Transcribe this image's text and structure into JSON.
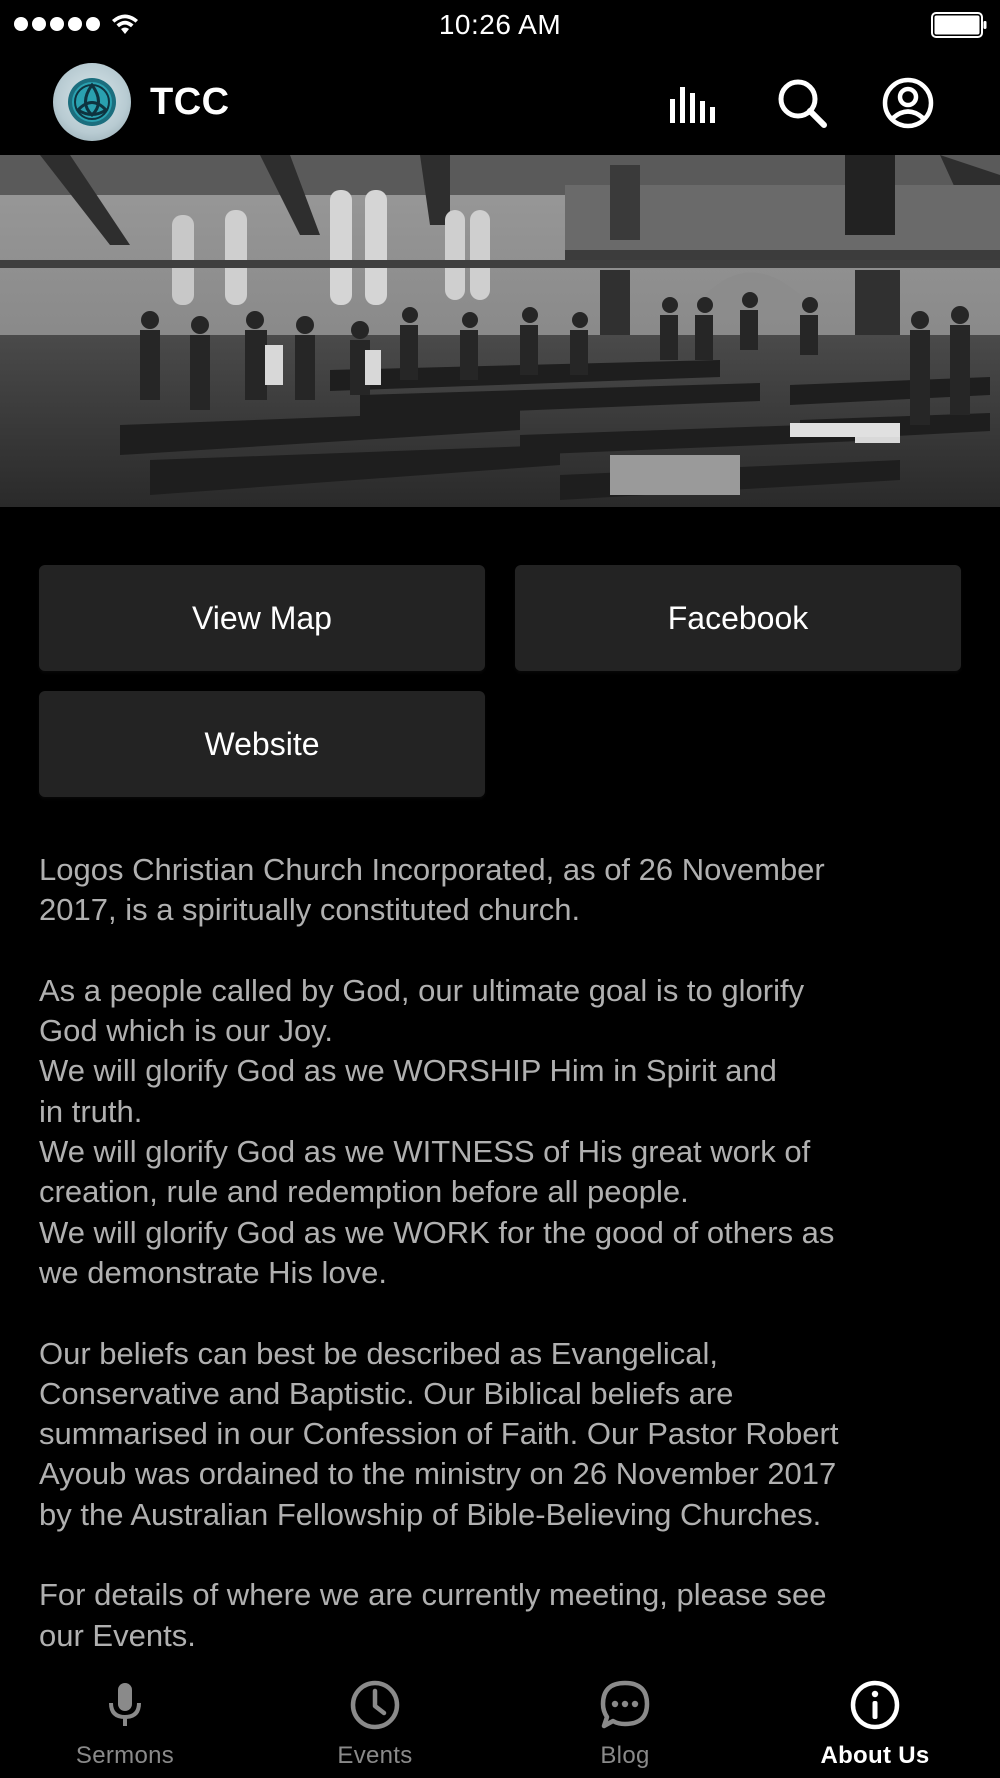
{
  "status_bar": {
    "time": "10:26 AM",
    "signal_bars": 5,
    "battery_level": 1.0
  },
  "header": {
    "title": "TCC",
    "icons": [
      "equalizer-icon",
      "search-icon",
      "account-icon"
    ]
  },
  "hero": {
    "image": "church-congregation-photo"
  },
  "buttons": {
    "view_map": "View Map",
    "facebook": "Facebook",
    "website": "Website"
  },
  "about": {
    "paragraph_1": "Logos Christian Church Incorporated, as of 26 November\n2017, is a spiritually constituted church.",
    "paragraph_2": "As a people called by God, our ultimate goal is to glorify\nGod which is our Joy.\nWe will glorify God as we WORSHIP Him in Spirit and\nin truth.\nWe will glorify God as we WITNESS of His great work of\ncreation, rule and redemption before all people.\nWe will glorify God as we WORK for the good of others as\nwe demonstrate His love.",
    "paragraph_3": "Our beliefs can best be described as Evangelical,\nConservative and Baptistic. Our Biblical beliefs are\nsummarised in our Confession of Faith. Our Pastor Robert\nAyoub was ordained to the ministry on 26 November 2017\nby the Australian Fellowship of Bible-Believing Churches.",
    "paragraph_4": "For details of where we are currently meeting, please see\nour Events."
  },
  "tabs": [
    {
      "label": "Sermons",
      "icon": "microphone-icon",
      "active": false
    },
    {
      "label": "Events",
      "icon": "clock-icon",
      "active": false
    },
    {
      "label": "Blog",
      "icon": "chat-bubble-icon",
      "active": false
    },
    {
      "label": "About Us",
      "icon": "info-icon",
      "active": true
    }
  ],
  "colors": {
    "background": "#000000",
    "button_bg": "#232323",
    "body_text": "#b0b0b0",
    "inactive_tab": "#8a8a8a"
  }
}
